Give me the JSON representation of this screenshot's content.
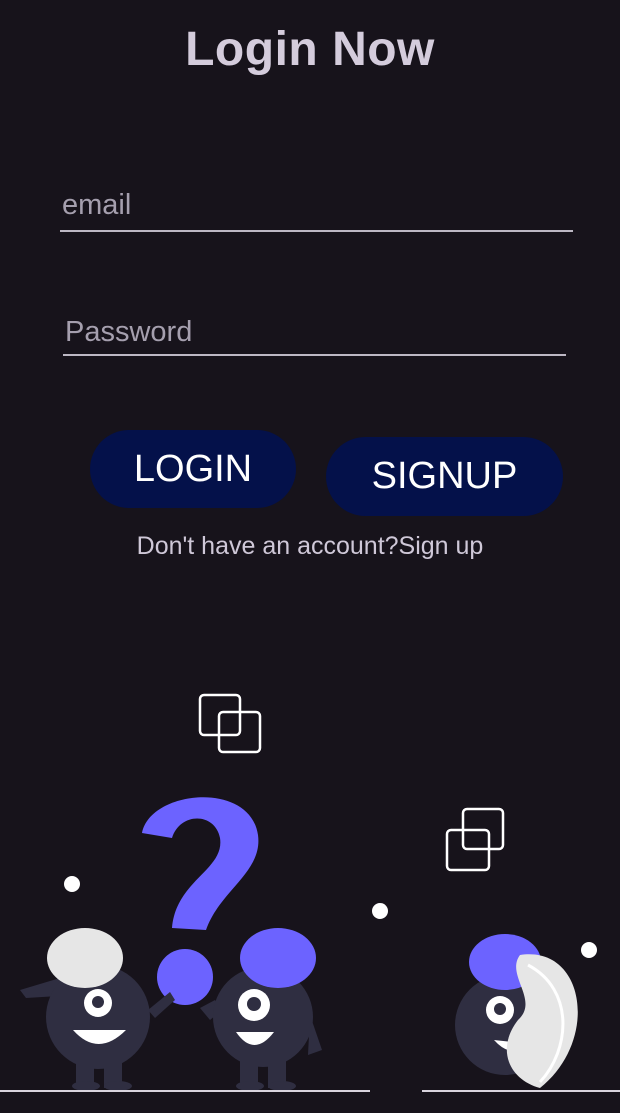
{
  "page": {
    "title": "Login Now"
  },
  "form": {
    "email_placeholder": "email",
    "email_value": "",
    "password_placeholder": "Password",
    "password_value": ""
  },
  "buttons": {
    "login_label": "LOGIN",
    "signup_label": "SIGNUP"
  },
  "footer": {
    "signup_prompt": "Don't have an account?Sign up"
  },
  "colors": {
    "background": "#17131b",
    "button_bg": "#04114a",
    "accent_purple": "#6c63ff",
    "character_dark": "#2f2e41",
    "character_light": "#e6e6e6"
  },
  "icons": {
    "overlap_squares": "copy-squares-icon",
    "question": "question-mark"
  }
}
